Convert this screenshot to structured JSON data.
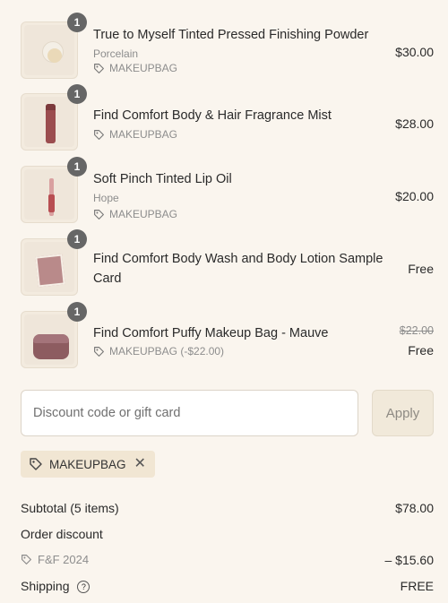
{
  "items": [
    {
      "name": "True to Myself Tinted Pressed Finishing Powder",
      "variant": "Porcelain",
      "discount": "MAKEUPBAG",
      "price": "$30.00",
      "qty": "1"
    },
    {
      "name": "Find Comfort Body & Hair Fragrance Mist",
      "discount": "MAKEUPBAG",
      "price": "$28.00",
      "qty": "1"
    },
    {
      "name": "Soft Pinch Tinted Lip Oil",
      "variant": "Hope",
      "discount": "MAKEUPBAG",
      "price": "$20.00",
      "qty": "1"
    },
    {
      "name_line1": "Find Comfort Body Wash and Body Lotion Sample",
      "name_line2": "Card",
      "price": "Free",
      "qty": "1"
    },
    {
      "name": "Find Comfort Puffy Makeup Bag - Mauve",
      "discount": "MAKEUPBAG (-$22.00)",
      "original_price": "$22.00",
      "price": "Free",
      "qty": "1"
    }
  ],
  "discount_form": {
    "placeholder": "Discount code or gift card",
    "value": "",
    "apply_label": "Apply"
  },
  "applied_code": "MAKEUPBAG",
  "summary": {
    "subtotal_label": "Subtotal (5 items)",
    "subtotal_value": "$78.00",
    "order_discount_label": "Order discount",
    "discount_code": "F&F 2024",
    "discount_value": "– $15.60",
    "shipping_label": "Shipping",
    "shipping_value": "FREE"
  },
  "colors": {
    "background": "#faf5ee",
    "badge": "#666666",
    "chip": "#f1e6d3",
    "apply_button": "#f1e9da"
  },
  "icons": {
    "tag": "tag-icon",
    "remove": "close-icon",
    "help": "question-circle-icon"
  }
}
